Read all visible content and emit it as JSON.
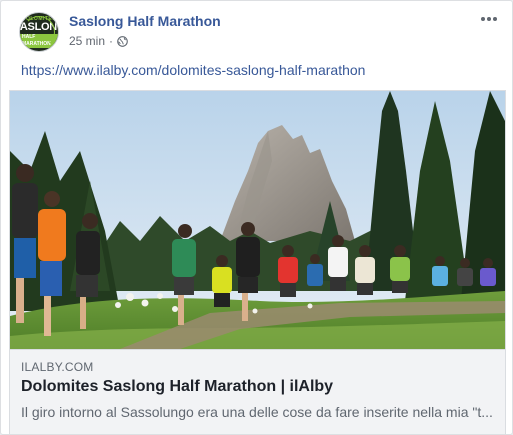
{
  "post": {
    "page_name": "Saslong Half Marathon",
    "time": "25 min",
    "separator": "·",
    "privacy_icon": "globe-icon",
    "more_icon": "more-dots-icon",
    "link_text": "https://www.ilalby.com/dolomites-saslong-half-marathon"
  },
  "avatar": {
    "line1": "DOLOMITES",
    "line2": "SASLONG",
    "line3": "HALF MARATHON"
  },
  "link_card": {
    "domain": "ILALBY.COM",
    "title": "Dolomites Saslong Half Marathon | ilAlby",
    "description": "Il giro intorno al Sassolungo era una delle cose da fare inserite nella mia \"t..."
  },
  "colors": {
    "link": "#385898",
    "meta": "#616770",
    "card_bg": "#f2f3f5",
    "brand_green": "#8cc63f"
  }
}
